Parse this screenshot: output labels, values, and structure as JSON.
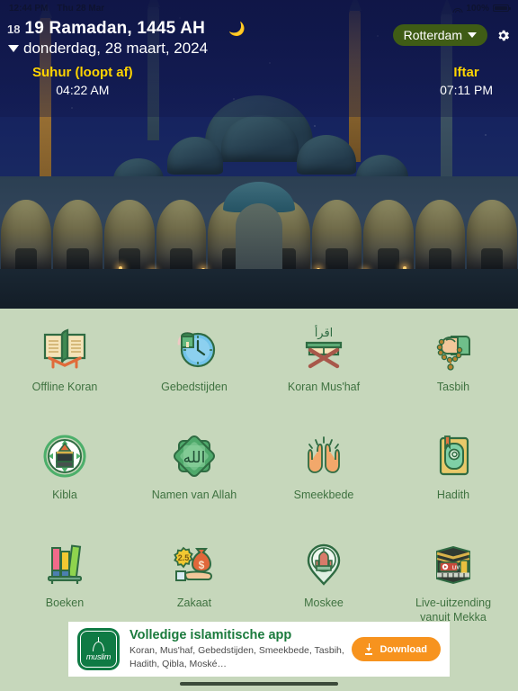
{
  "statusbar": {
    "time": "12:44 PM",
    "date": "Thu 28 Mar",
    "battery_percent": "100%",
    "wifi_icon": "wifi-icon",
    "battery_icon": "battery-icon"
  },
  "header": {
    "prev_day": "18",
    "hijri_date": "19 Ramadan, 1445 AH",
    "gregorian_date": "donderdag, 28 maart, 2024",
    "moon_icon": "crescent-moon-icon",
    "caret_icon": "caret-down-icon",
    "location": "Rotterdam",
    "location_caret_icon": "chevron-down-icon",
    "settings_icon": "gear-icon"
  },
  "times": {
    "suhur": {
      "label": "Suhur (loopt af)",
      "value": "04:22 AM"
    },
    "iftar": {
      "label": "Iftar",
      "value": "07:11 PM"
    }
  },
  "hero": {
    "alt": "blue-mosque-night-photo"
  },
  "grid": {
    "rows": [
      [
        {
          "label": "Offline Koran",
          "icon": "open-quran-book-icon"
        },
        {
          "label": "Gebedstijden",
          "icon": "prayer-clock-icon"
        },
        {
          "label": "Koran Mus'haf",
          "icon": "mushaf-rehal-icon",
          "arabic": "اقرأ"
        },
        {
          "label": "Tasbih",
          "icon": "prayer-beads-hand-icon"
        }
      ],
      [
        {
          "label": "Kibla",
          "icon": "qibla-compass-icon"
        },
        {
          "label": "Namen van Allah",
          "icon": "allah-name-star-icon",
          "arabic": "الله"
        },
        {
          "label": "Smeekbede",
          "icon": "praying-hands-icon"
        },
        {
          "label": "Hadith",
          "icon": "hadith-book-icon"
        }
      ],
      [
        {
          "label": "Boeken",
          "icon": "books-shelf-icon"
        },
        {
          "label": "Zakaat",
          "icon": "zakat-money-bag-icon",
          "badge": "2.5"
        },
        {
          "label": "Moskee",
          "icon": "mosque-location-pin-icon"
        },
        {
          "label": "Live-uitzending vanuit Mekka",
          "icon": "kaaba-live-icon",
          "badge": "LIVE"
        }
      ]
    ]
  },
  "ad": {
    "logo_icon": "muslim-app-logo-icon",
    "logo_word": "muslim",
    "title": "Volledige islamitische app",
    "description": "Koran, Mus'haf, Gebedstijden, Smeekbede, Tasbih, Hadith, Qibla, Moské…",
    "button_label": "Download",
    "button_icon": "download-arrow-icon",
    "button_color": "#f7931e"
  },
  "colors": {
    "grid_background": "#c6d7bb",
    "label_green": "#3f7240",
    "pill_green": "#3f5c15",
    "accent_yellow": "#ffd400",
    "ad_title_green": "#1a7a3c"
  }
}
